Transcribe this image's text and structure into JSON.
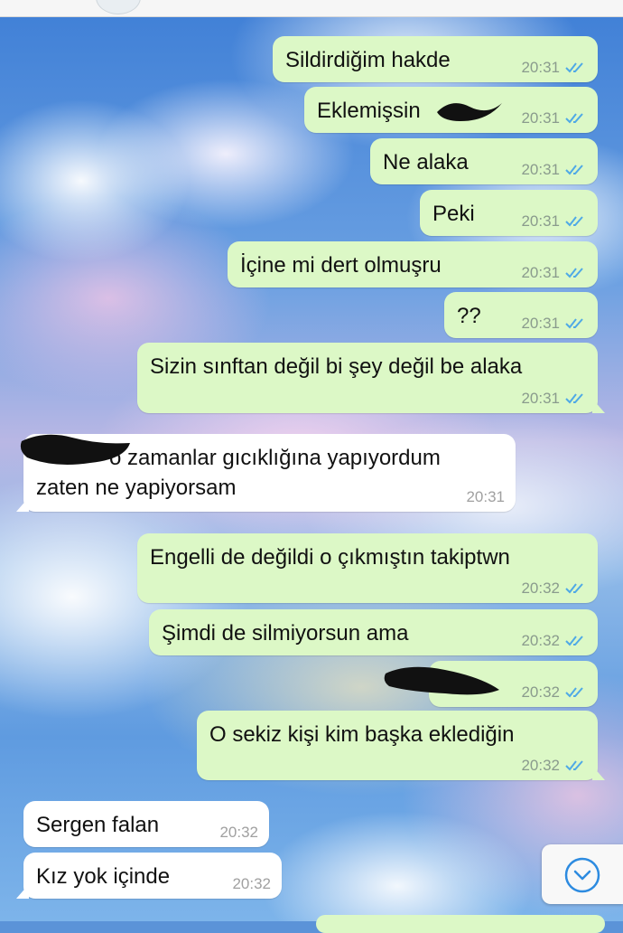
{
  "colors": {
    "outgoing_bubble": "#dcf8c6",
    "incoming_bubble": "#ffffff",
    "read_ticks": "#4fa9e6",
    "scroll_button_icon": "#2d8be0"
  },
  "messages": [
    {
      "direction": "out",
      "text": "Sildirdiğim hakde",
      "time": "20:31",
      "status": "read"
    },
    {
      "direction": "out",
      "text": "Eklemişsin",
      "time": "20:31",
      "status": "read",
      "redacted_suffix": true
    },
    {
      "direction": "out",
      "text": "Ne alaka",
      "time": "20:31",
      "status": "read"
    },
    {
      "direction": "out",
      "text": "Peki",
      "time": "20:31",
      "status": "read"
    },
    {
      "direction": "out",
      "text": "İçine mi dert olmuşru",
      "time": "20:31",
      "status": "read"
    },
    {
      "direction": "out",
      "text": "??",
      "time": "20:31",
      "status": "read"
    },
    {
      "direction": "out",
      "text": "Sizin sınftan değil bi şey değil be alaka",
      "time": "20:31",
      "status": "read"
    },
    {
      "direction": "in",
      "text_line1": "o zamanlar gıcıklığına yapıyordum",
      "text_line2": "zaten ne yapiyorsam",
      "time": "20:31",
      "redacted_prefix": true
    },
    {
      "direction": "out",
      "text": "Engelli de değildi o çıkmıştın takiptwn",
      "time": "20:32",
      "status": "read"
    },
    {
      "direction": "out",
      "text": "Şimdi de silmiyorsun ama",
      "time": "20:32",
      "status": "read"
    },
    {
      "direction": "out",
      "text": "",
      "time": "20:32",
      "status": "read",
      "redacted": true
    },
    {
      "direction": "out",
      "text": "O sekiz kişi kim başka eklediğin",
      "time": "20:32",
      "status": "read"
    },
    {
      "direction": "in",
      "text": "Sergen falan",
      "time": "20:32"
    },
    {
      "direction": "in",
      "text": "Kız yok içinde",
      "time": "20:32"
    }
  ],
  "scroll_button": {
    "icon": "chevron-down-circle-icon"
  }
}
